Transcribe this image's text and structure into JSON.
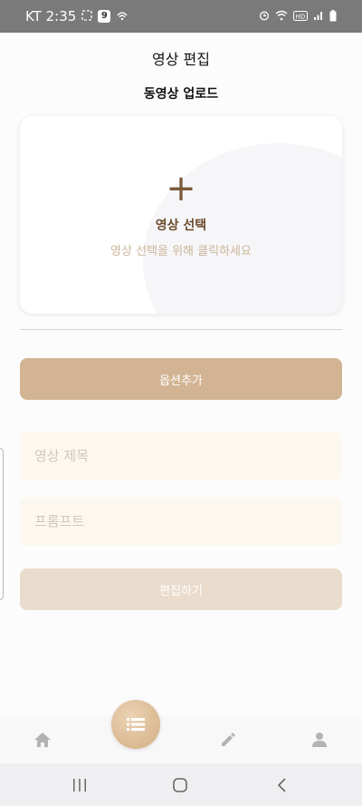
{
  "status_bar": {
    "carrier_time": "KT 2:35",
    "badge": "9",
    "icons_left": [
      "screenshot-icon",
      "calendar-badge-icon",
      "wifi-calling-icon"
    ],
    "icons_right": [
      "alarm-icon",
      "wifi-icon",
      "hd-icon",
      "signal-icon",
      "battery-icon"
    ]
  },
  "header": {
    "title": "영상 편집"
  },
  "upload": {
    "section_title": "동영상 업로드",
    "plus": "+",
    "label": "영상 선택",
    "hint": "영상 선택을 위해 클릭하세요"
  },
  "option_button": "옵션추가",
  "inputs": {
    "title_placeholder": "영상 제목",
    "prompt_placeholder": "프롬프트"
  },
  "edit_button": "편집하기",
  "bottom_nav": [
    "home-icon",
    "list-icon",
    "pencil-icon",
    "person-icon"
  ],
  "colors": {
    "accent": "#d2b494",
    "accent_light": "#eadccc",
    "input_bg": "#fdf8ef",
    "label_brown": "#6b4a2a",
    "nav_icon": "#b3b3b3"
  }
}
